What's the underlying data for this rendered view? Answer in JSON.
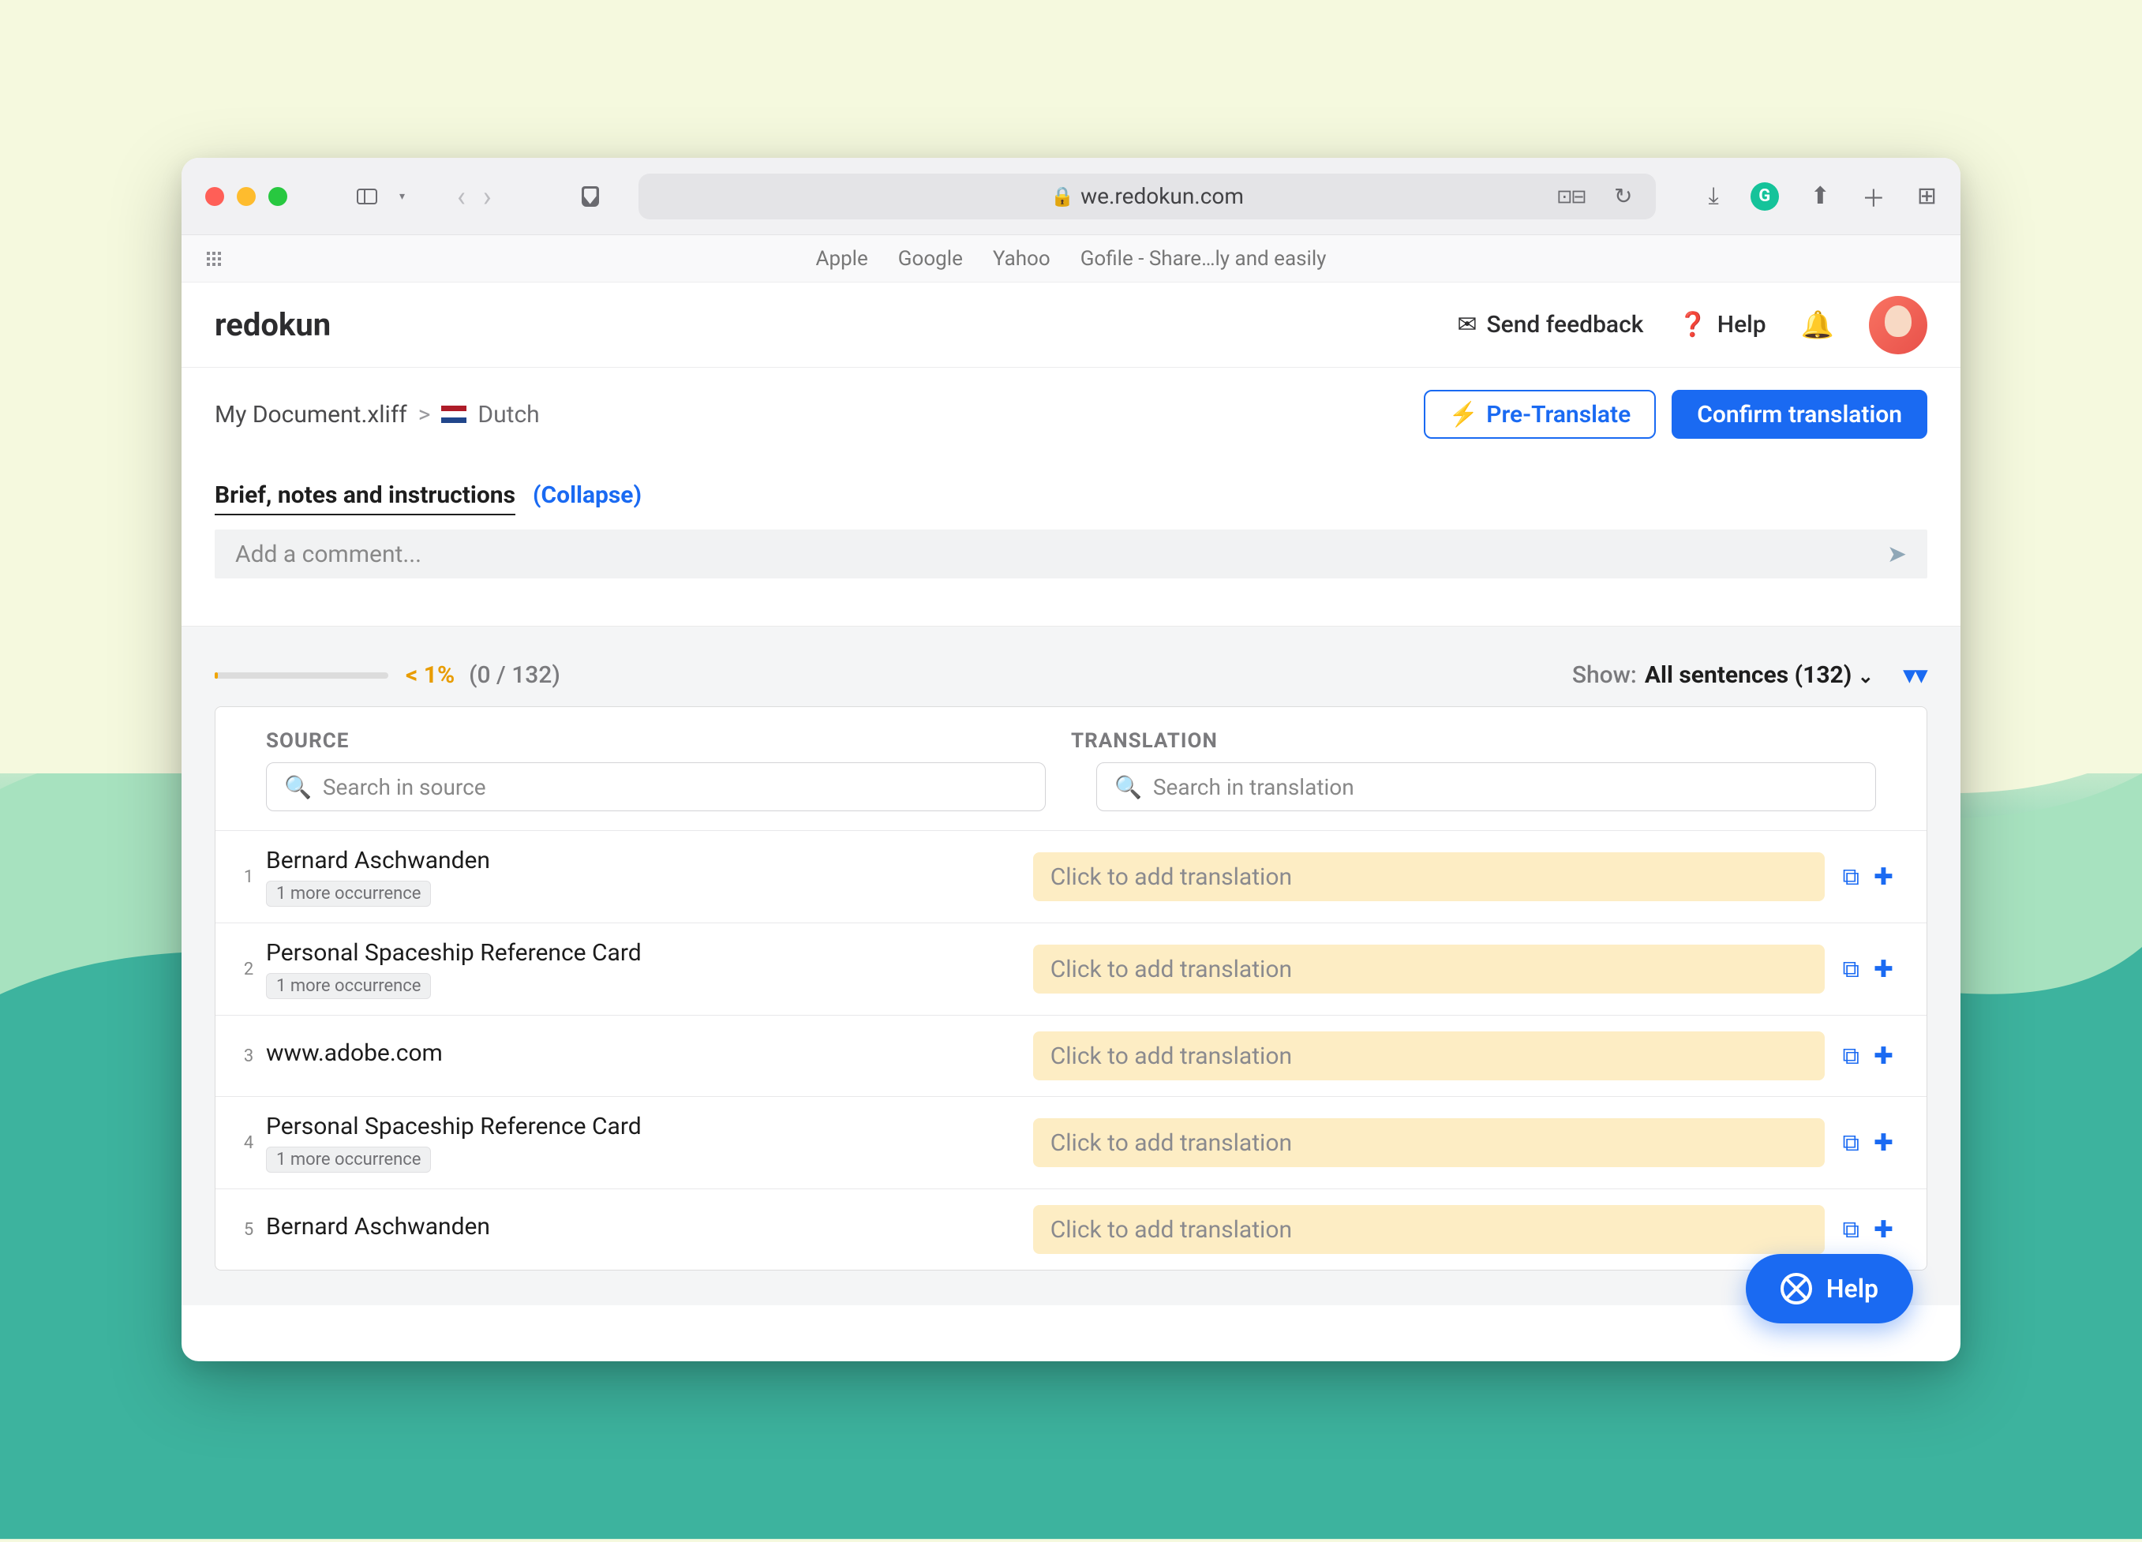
{
  "url": "we.redokun.com",
  "bookmarks": [
    "Apple",
    "Google",
    "Yahoo",
    "Gofile - Share…ly and easily"
  ],
  "logo": "redokun",
  "header_links": {
    "feedback": "Send feedback",
    "help": "Help"
  },
  "breadcrumb": {
    "doc": "My Document.xliff",
    "sep": ">",
    "lang": "Dutch"
  },
  "buttons": {
    "pretranslate": "Pre-Translate",
    "confirm": "Confirm translation"
  },
  "brief": {
    "title": "Brief, notes and instructions",
    "collapse": "(Collapse)",
    "placeholder": "Add a comment..."
  },
  "stats": {
    "percent": "< 1%",
    "count": "(0 / 132)",
    "show_label": "Show:",
    "show_value": "All sentences (132)"
  },
  "columns": {
    "source": "SOURCE",
    "translation": "TRANSLATION"
  },
  "search": {
    "source": "Search in source",
    "translation": "Search in translation"
  },
  "placeholder_translation": "Click to add translation",
  "occurrence_badge": "1 more occurrence",
  "rows": [
    {
      "n": "1",
      "text": "Bernard Aschwanden",
      "badge": true
    },
    {
      "n": "2",
      "text": "Personal Spaceship Reference Card",
      "badge": true
    },
    {
      "n": "3",
      "text": "www.adobe.com",
      "badge": false
    },
    {
      "n": "4",
      "text": "Personal Spaceship Reference Card",
      "badge": true
    },
    {
      "n": "5",
      "text": "Bernard Aschwanden",
      "badge": false
    }
  ],
  "help_label": "Help"
}
